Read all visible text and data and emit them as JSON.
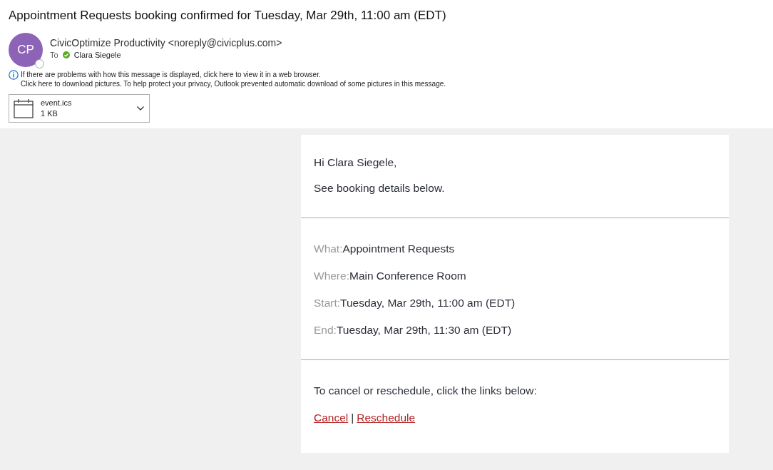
{
  "subject": "Appointment Requests booking confirmed for Tuesday, Mar 29th, 11:00 am (EDT)",
  "sender": {
    "initials": "CP",
    "name": "CivicOptimize Productivity <noreply@civicplus.com>",
    "to_label": "To",
    "recipient": "Clara Siegele"
  },
  "notices": [
    "If there are problems with how this message is displayed, click here to view it in a web browser.",
    "Click here to download pictures. To help protect your privacy, Outlook prevented automatic download of some pictures in this message."
  ],
  "attachment": {
    "name": "event.ics",
    "size": "1 KB"
  },
  "body": {
    "greeting": "Hi Clara Siegele,",
    "intro": "See booking details below.",
    "details": [
      {
        "label": "What:",
        "value": "Appointment Requests"
      },
      {
        "label": "Where:",
        "value": "Main Conference Room"
      },
      {
        "label": "Start:",
        "value": "Tuesday, Mar 29th, 11:00 am (EDT)"
      },
      {
        "label": "End:",
        "value": "Tuesday, Mar 29th, 11:30 am (EDT)"
      }
    ],
    "action_text": "To cancel or reschedule, click the links below:",
    "links": [
      "Cancel",
      "Reschedule"
    ],
    "link_separator": "|"
  }
}
